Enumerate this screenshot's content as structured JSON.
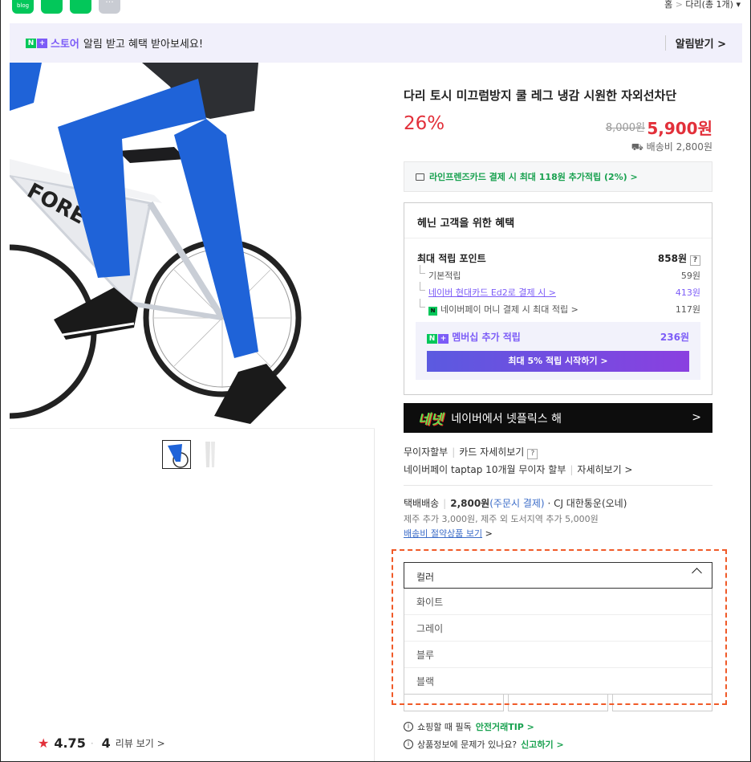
{
  "top_icons": [
    {
      "name": "blog-icon",
      "label": "blog"
    },
    {
      "name": "cafe-icon",
      "label": ""
    },
    {
      "name": "bookmark-icon",
      "label": ""
    },
    {
      "name": "more-icon",
      "label": "···"
    }
  ],
  "breadcrumb": {
    "home": "홈",
    "sep": ">",
    "current": "다리(총 1개)"
  },
  "banner": {
    "badge_n": "N",
    "badge_plus": "+",
    "store": "스토어",
    "message": "알림 받고 혜택 받아보세요!",
    "action": "알림받기 >"
  },
  "product": {
    "title": "다리 토시 미끄럼방지 쿨 레그 냉감 시원한 자외선차단",
    "discount": "26%",
    "original_price": "8,000원",
    "price": "5,900원",
    "shipping": "배송비 2,800원"
  },
  "card_promo": "라인프렌즈카드 결제 시 최대 118원 추가적립 (2%) >",
  "benefits": {
    "heading": "헤닌 고객을 위한 혜택",
    "max_label": "최대 적립 포인트",
    "max_value": "858원",
    "help": "?",
    "rows": [
      {
        "label": "기본적립",
        "value": "59원"
      },
      {
        "label": "네이버 현대카드 Ed2로 결제 시 >",
        "value": "413원"
      },
      {
        "label": "네이버페이 머니 결제 시 최대 적립 >",
        "value": "117원"
      }
    ],
    "membership_label": "멤버십 추가 적립",
    "membership_value": "236원",
    "membership_button": "최대 5% 적립 시작하기 >"
  },
  "netflix": {
    "logo": "네넷",
    "text": "네이버에서 넷플릭스 해",
    "chevron": ">"
  },
  "installment": {
    "line1a": "무이자할부",
    "line1b": "카드 자세히보기",
    "help": "?",
    "line2a": "네이버페이 taptap 10개월 무이자 할부",
    "line2b": "자세히보기 >"
  },
  "delivery": {
    "type": "택배배송",
    "fee": "2,800원",
    "fee_note": "(주문시 결제)",
    "carrier": "· CJ 대한통운(오네)",
    "extra": "제주 추가 3,000원, 제주 외 도서지역 추가 5,000원",
    "link": "배송비 절약상품 보기",
    "link_chev": ">"
  },
  "option_select": {
    "placeholder": "컬러",
    "options": [
      "화이트",
      "그레이",
      "블루",
      "블랙"
    ]
  },
  "tips": [
    {
      "icon": "i",
      "text": "쇼핑할 때 필독",
      "link": "안전거래TIP >"
    },
    {
      "icon": "i",
      "text": "상품정보에 문제가 있나요?",
      "link": "신고하기 >"
    }
  ],
  "rating": {
    "star": "★",
    "score": "4.75",
    "dot": "·",
    "count": "4",
    "link": "리뷰 보기 >"
  },
  "colors": {
    "accent": "#e2303a",
    "brand_green": "#03c75a",
    "purple": "#7c5cf7",
    "highlight": "#f05a28"
  }
}
